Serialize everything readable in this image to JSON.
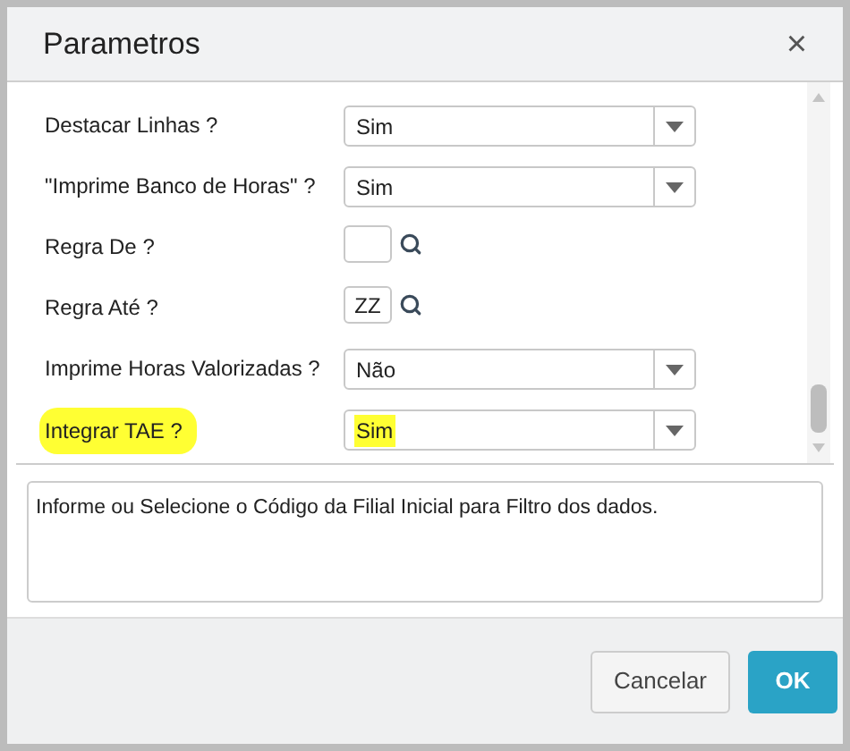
{
  "dialog": {
    "title": "Parametros",
    "close": "×"
  },
  "fields": [
    {
      "kind": "select",
      "label": "Destacar Linhas ?",
      "value": "Sim",
      "highlighted": false
    },
    {
      "kind": "select",
      "label": "\"Imprime Banco de Horas\" ?",
      "value": "Sim",
      "highlighted": false
    },
    {
      "kind": "lookup",
      "label": "Regra De ?",
      "highlighted": false
    },
    {
      "kind": "lookup",
      "label": "Regra Até ?",
      "value": "ZZ",
      "highlighted": false
    },
    {
      "kind": "select",
      "label": "Imprime Horas Valorizadas ?",
      "value": "Não",
      "highlighted": false
    },
    {
      "kind": "select",
      "label": "Integrar TAE ?",
      "value": "Sim",
      "highlighted": true
    }
  ],
  "help_text": "Informe ou Selecione o Código da Filial Inicial para Filtro dos dados.",
  "buttons": [
    {
      "label": "Cancelar",
      "kind": "secondary"
    },
    {
      "label": "OK",
      "kind": "primary"
    }
  ]
}
